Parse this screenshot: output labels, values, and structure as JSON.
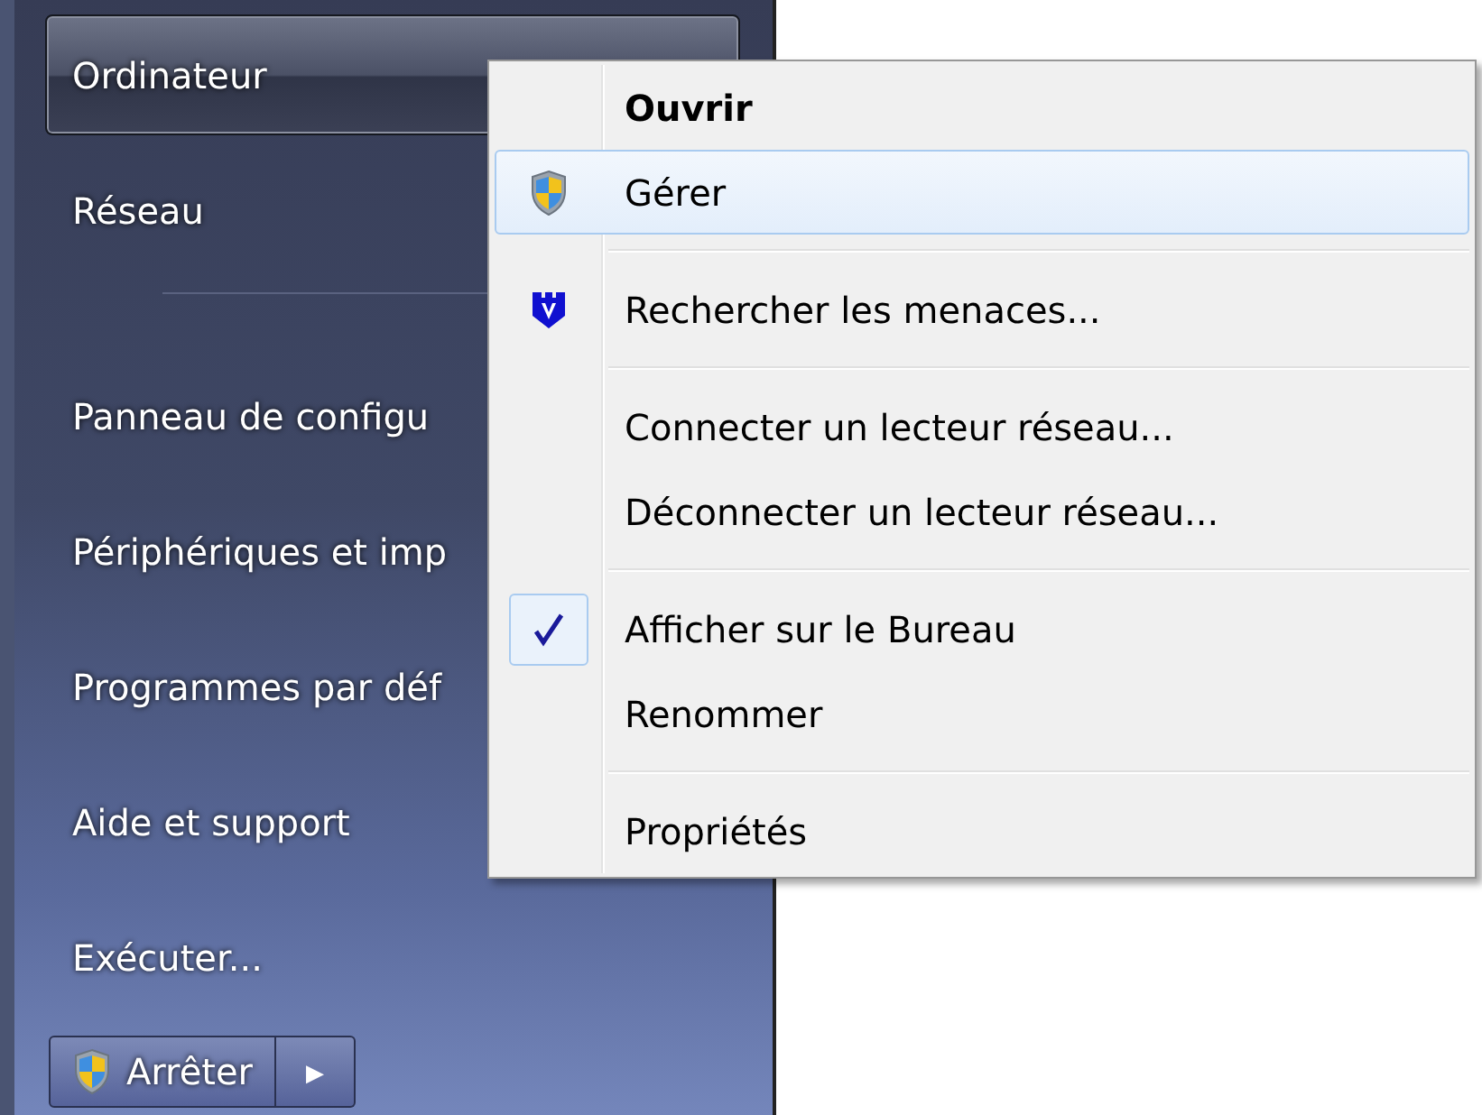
{
  "start_menu": {
    "items": [
      {
        "kind": "item",
        "label": "Ordinateur",
        "selected": true
      },
      {
        "kind": "item",
        "label": "Réseau",
        "selected": false
      },
      {
        "kind": "separator"
      },
      {
        "kind": "item",
        "label": "Panneau de configu",
        "selected": false
      },
      {
        "kind": "item",
        "label": "Périphériques et imp",
        "selected": false
      },
      {
        "kind": "item",
        "label": "Programmes par déf",
        "selected": false
      },
      {
        "kind": "item",
        "label": "Aide et support",
        "selected": false
      },
      {
        "kind": "item",
        "label": "Exécuter...",
        "selected": false
      }
    ],
    "shutdown_button": {
      "label": "Arrêter"
    },
    "options_button": {
      "label": "▶"
    }
  },
  "context_menu": {
    "items": [
      {
        "kind": "plain",
        "label": "Ouvrir",
        "default": true,
        "selected": false,
        "checked": false
      },
      {
        "kind": "uac",
        "label": "Gérer",
        "default": false,
        "selected": true,
        "checked": false
      },
      {
        "kind": "separator"
      },
      {
        "kind": "antivirus",
        "label": "Rechercher les menaces...",
        "default": false,
        "selected": false,
        "checked": false
      },
      {
        "kind": "separator"
      },
      {
        "kind": "plain",
        "label": "Connecter un lecteur réseau...",
        "default": false,
        "selected": false,
        "checked": false
      },
      {
        "kind": "plain",
        "label": "Déconnecter un lecteur réseau...",
        "default": false,
        "selected": false,
        "checked": false
      },
      {
        "kind": "separator"
      },
      {
        "kind": "plain",
        "label": "Afficher sur le Bureau",
        "default": false,
        "selected": false,
        "checked": true
      },
      {
        "kind": "plain",
        "label": "Renommer",
        "default": false,
        "selected": false,
        "checked": false
      },
      {
        "kind": "separator"
      },
      {
        "kind": "plain",
        "label": "Propriétés",
        "default": false,
        "selected": false,
        "checked": false
      }
    ]
  }
}
